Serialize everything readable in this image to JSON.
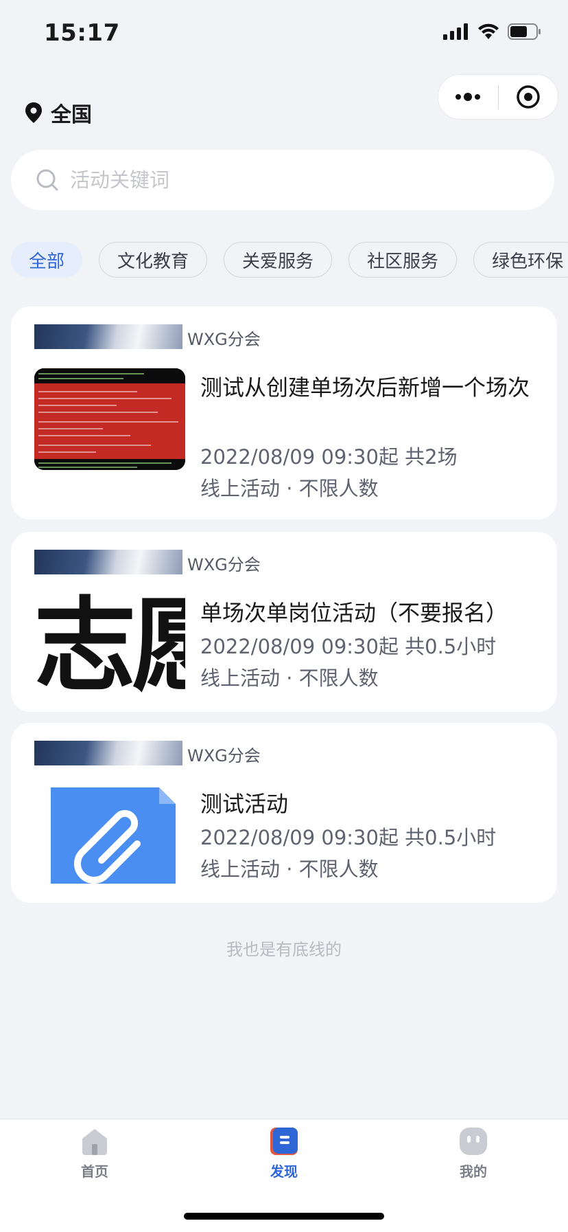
{
  "status_bar": {
    "time": "15:17"
  },
  "header": {
    "location": "全国"
  },
  "search": {
    "placeholder": "活动关键词"
  },
  "category_tabs": [
    {
      "label": "全部",
      "active": true
    },
    {
      "label": "文化教育",
      "active": false
    },
    {
      "label": "关爱服务",
      "active": false
    },
    {
      "label": "社区服务",
      "active": false
    },
    {
      "label": "绿色环保",
      "active": false
    }
  ],
  "activities": [
    {
      "org": "WXG分会",
      "title": "测试从创建单场次后新增一个场次",
      "time": "2022/08/09 09:30起 共2场",
      "info": "线上活动 · 不限人数",
      "thumb": "terminal-screenshot"
    },
    {
      "org": "WXG分会",
      "title": "单场次单岗位活动（不要报名）",
      "time": "2022/08/09 09:30起 共0.5小时",
      "info": "线上活动 · 不限人数",
      "thumb": "calligraphy-text",
      "thumb_text": "志愿"
    },
    {
      "org": "WXG分会",
      "title": "测试活动",
      "time": "2022/08/09 09:30起 共0.5小时",
      "info": "线上活动 · 不限人数",
      "thumb": "attachment-file"
    }
  ],
  "footer_note": "我也是有底线的",
  "tabbar": [
    {
      "label": "首页",
      "icon": "home-icon",
      "active": false
    },
    {
      "label": "发现",
      "icon": "discover-icon",
      "active": true
    },
    {
      "label": "我的",
      "icon": "profile-icon",
      "active": false
    }
  ],
  "colors": {
    "accent": "#2f66d6",
    "background": "#f2f3f7"
  }
}
